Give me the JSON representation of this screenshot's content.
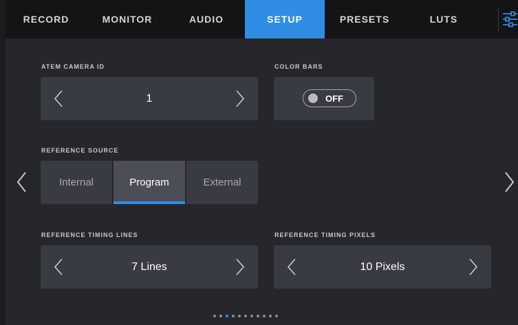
{
  "tabs": [
    {
      "label": "RECORD",
      "active": false
    },
    {
      "label": "MONITOR",
      "active": false
    },
    {
      "label": "AUDIO",
      "active": false
    },
    {
      "label": "SETUP",
      "active": true
    },
    {
      "label": "PRESETS",
      "active": false
    },
    {
      "label": "LUTS",
      "active": false
    }
  ],
  "menu_icon": "settings-sliders-icon",
  "atem_camera_id": {
    "label": "ATEM CAMERA ID",
    "value": "1"
  },
  "color_bars": {
    "label": "COLOR BARS",
    "state": "OFF"
  },
  "reference_source": {
    "label": "REFERENCE SOURCE",
    "options": [
      "Internal",
      "Program",
      "External"
    ],
    "selected": "Program"
  },
  "reference_timing_lines": {
    "label": "REFERENCE TIMING LINES",
    "value": "7 Lines"
  },
  "reference_timing_pixels": {
    "label": "REFERENCE TIMING PIXELS",
    "value": "10 Pixels"
  },
  "pagination": {
    "total": 11,
    "current": 3
  },
  "colors": {
    "accent": "#2f8de4",
    "panel": "#393b42",
    "background": "#26272b",
    "tabbar": "#141416"
  }
}
